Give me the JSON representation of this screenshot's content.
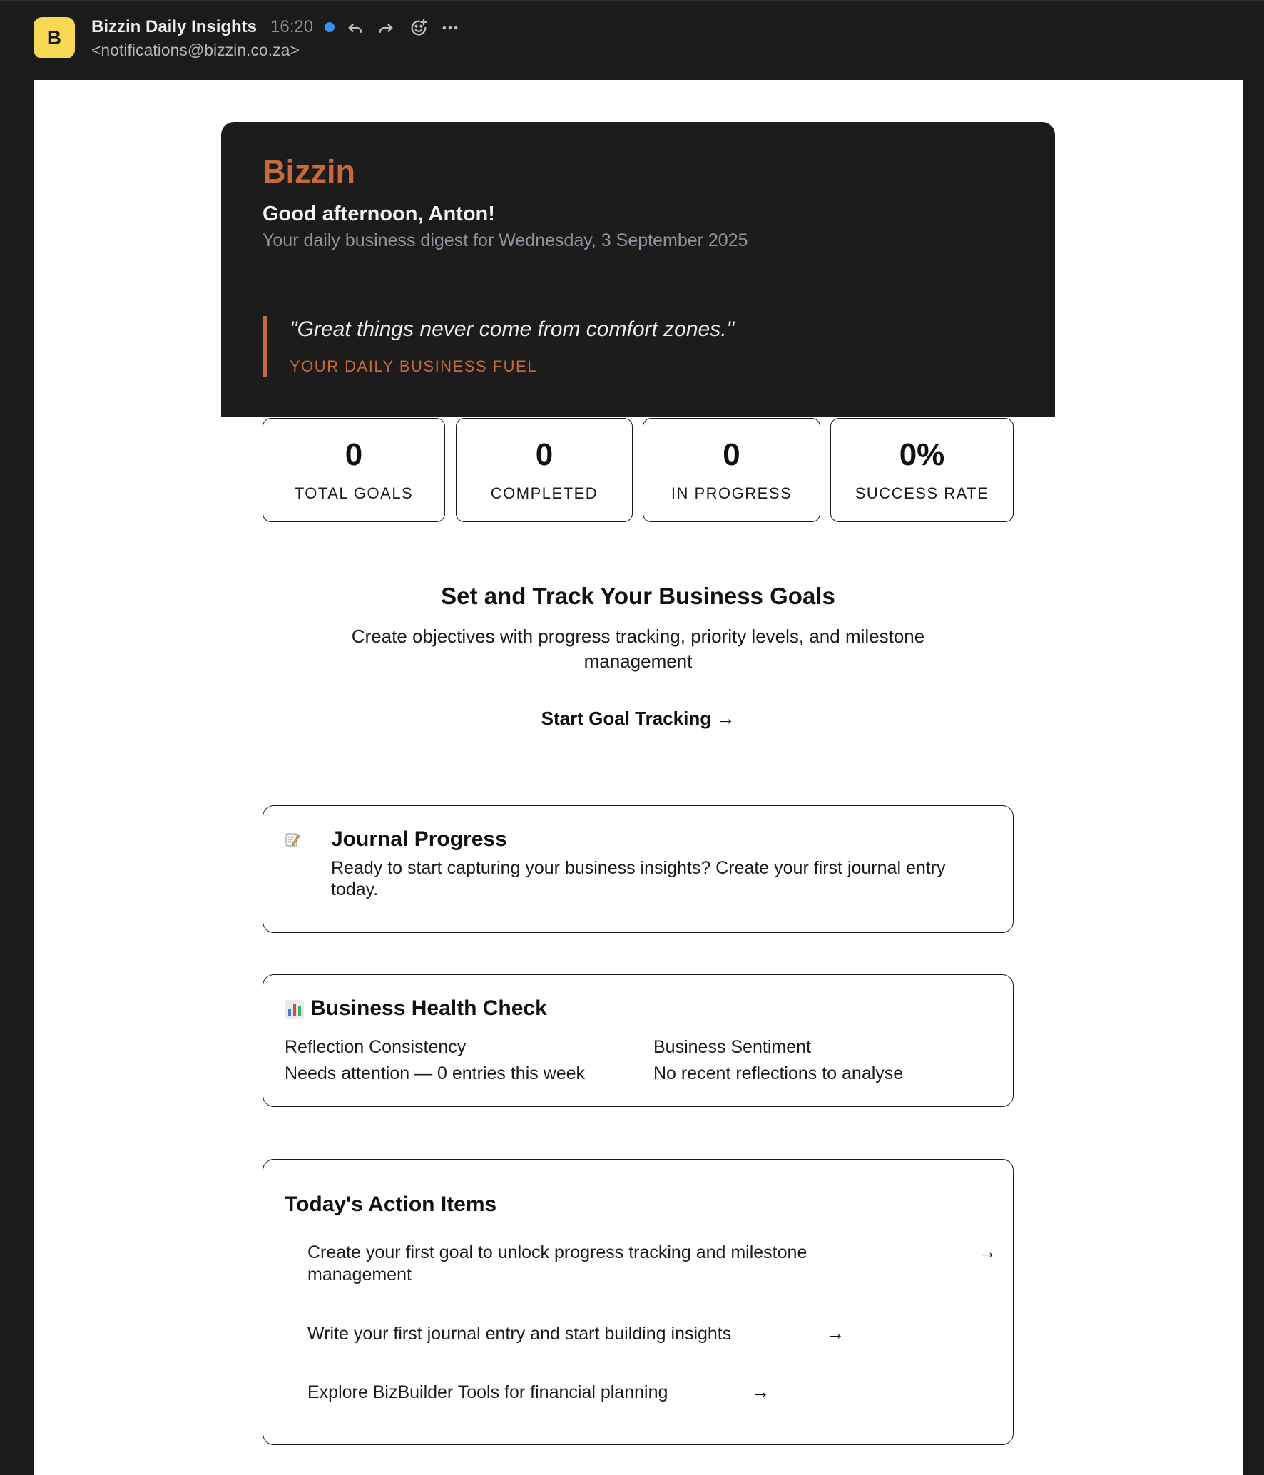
{
  "mail": {
    "avatar_letter": "B",
    "sender": "Bizzin Daily Insights",
    "time": "16:20",
    "address": "<notifications@bizzin.co.za>",
    "icons": [
      "reply-icon",
      "forward-icon",
      "add-reaction-icon",
      "more-icon"
    ]
  },
  "hero": {
    "brand": "Bizzin",
    "greeting": "Good afternoon, Anton!",
    "digest": "Your daily business digest for Wednesday, 3 September 2025",
    "quote": "\"Great things never come from comfort zones.\"",
    "quote_caption": "YOUR DAILY BUSINESS FUEL"
  },
  "stats": [
    {
      "value": "0",
      "label": "TOTAL GOALS"
    },
    {
      "value": "0",
      "label": "COMPLETED"
    },
    {
      "value": "0",
      "label": "IN PROGRESS"
    },
    {
      "value": "0%",
      "label": "SUCCESS RATE"
    }
  ],
  "goals": {
    "title": "Set and Track Your Business Goals",
    "description": "Create objectives with progress tracking, priority levels, and milestone management",
    "cta": "Start Goal Tracking →"
  },
  "journal": {
    "icon": "memo-icon",
    "title": "Journal Progress",
    "text": "Ready to start capturing your business insights? Create your first journal entry today."
  },
  "health": {
    "icon": "bar-chart-icon",
    "title": "Business Health Check",
    "metrics": [
      {
        "label": "Reflection Consistency",
        "value": "Needs attention — 0 entries this week"
      },
      {
        "label": "Business Sentiment",
        "value": "No recent reflections to analyse"
      }
    ]
  },
  "actions": {
    "title": "Today's Action Items",
    "items": [
      {
        "text": "Create your first goal to unlock progress tracking and milestone management",
        "arrow": "→"
      },
      {
        "text": "Write your first journal entry and start building insights",
        "arrow": "→"
      },
      {
        "text": "Explore BizBuilder Tools for financial planning",
        "arrow": "→"
      }
    ]
  },
  "colors": {
    "accent": "#c8693a",
    "avatar": "#f7d754",
    "unread": "#3b8ff0",
    "dark": "#1c1c1c"
  }
}
